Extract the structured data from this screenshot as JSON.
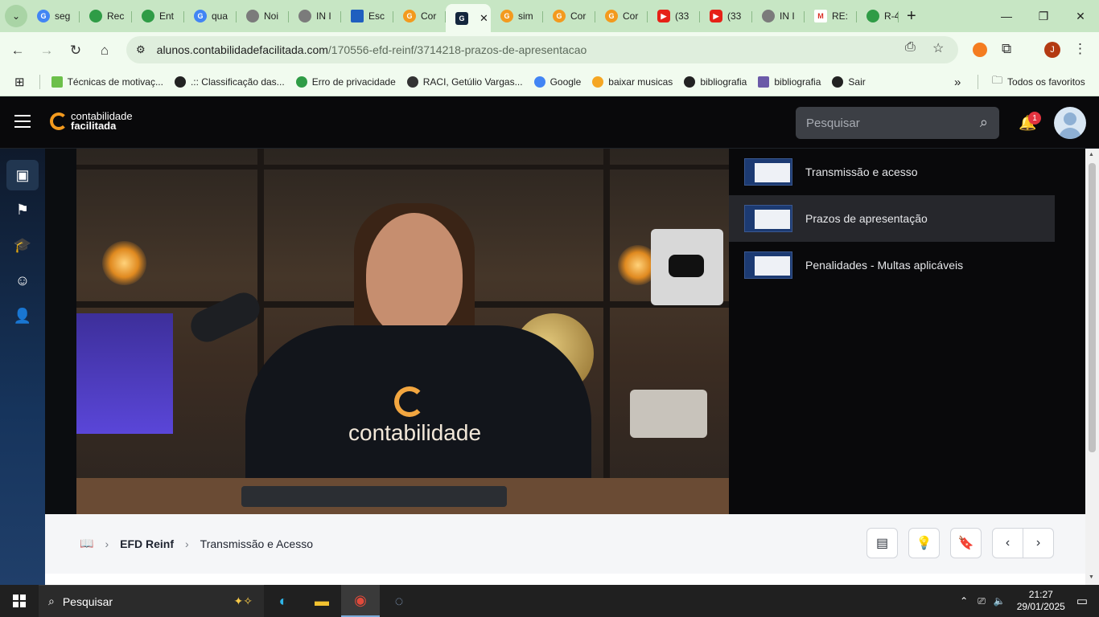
{
  "browser": {
    "tabs": [
      {
        "label": "seg",
        "favicon": "google-icon"
      },
      {
        "label": "Rec",
        "favicon": "brazil-flag-icon"
      },
      {
        "label": "Ent",
        "favicon": "brazil-flag-icon"
      },
      {
        "label": "qua",
        "favicon": "google-icon"
      },
      {
        "label": "Noi",
        "favicon": "globe-icon"
      },
      {
        "label": "IN I",
        "favicon": "globe-icon"
      },
      {
        "label": "Esc",
        "favicon": "grid-icon"
      },
      {
        "label": "Cor",
        "favicon": "contabilidade-icon"
      },
      {
        "label": "",
        "favicon": "contabilidade-dark-icon",
        "active": true
      },
      {
        "label": "sim",
        "favicon": "contabilidade-icon"
      },
      {
        "label": "Cor",
        "favicon": "contabilidade-icon"
      },
      {
        "label": "Cor",
        "favicon": "contabilidade-icon"
      },
      {
        "label": "(33",
        "favicon": "youtube-icon"
      },
      {
        "label": "(33",
        "favicon": "youtube-icon"
      },
      {
        "label": "IN I",
        "favicon": "globe-icon"
      },
      {
        "label": "RE:",
        "favicon": "gmail-icon"
      },
      {
        "label": "R-4",
        "favicon": "brazil-flag-icon"
      }
    ],
    "url_domain": "alunos.contabilidadefacilitada.com",
    "url_path": "/170556-efd-reinf/3714218-prazos-de-apresentacao",
    "profile_initial": "J",
    "bookmarks": [
      "Técnicas de motivaç...",
      ".:: Classificação das...",
      "Erro de privacidade",
      "RACI, Getúlio Vargas...",
      "Google",
      "baixar musicas",
      "bibliografia",
      "bibliografia",
      "Sair"
    ],
    "all_bookmarks": "Todos os favoritos"
  },
  "site": {
    "logo_line1": "contabilidade",
    "logo_line2": "facilitada",
    "search_placeholder": "Pesquisar",
    "notification_count": "1"
  },
  "video": {
    "shirt_text": "contabilidade"
  },
  "lessons": [
    {
      "title": "Transmissão e acesso"
    },
    {
      "title": "Prazos de apresentação",
      "current": true
    },
    {
      "title": "Penalidades - Multas aplicáveis"
    }
  ],
  "breadcrumb": {
    "course": "EFD Reinf",
    "module": "Transmissão e Acesso"
  },
  "taskbar": {
    "search_label": "Pesquisar",
    "time": "21:27",
    "date": "29/01/2025"
  },
  "colors": {
    "brand_orange": "#f39a1e",
    "chrome_green": "#c7e6c4",
    "badge_red": "#e2333f"
  }
}
